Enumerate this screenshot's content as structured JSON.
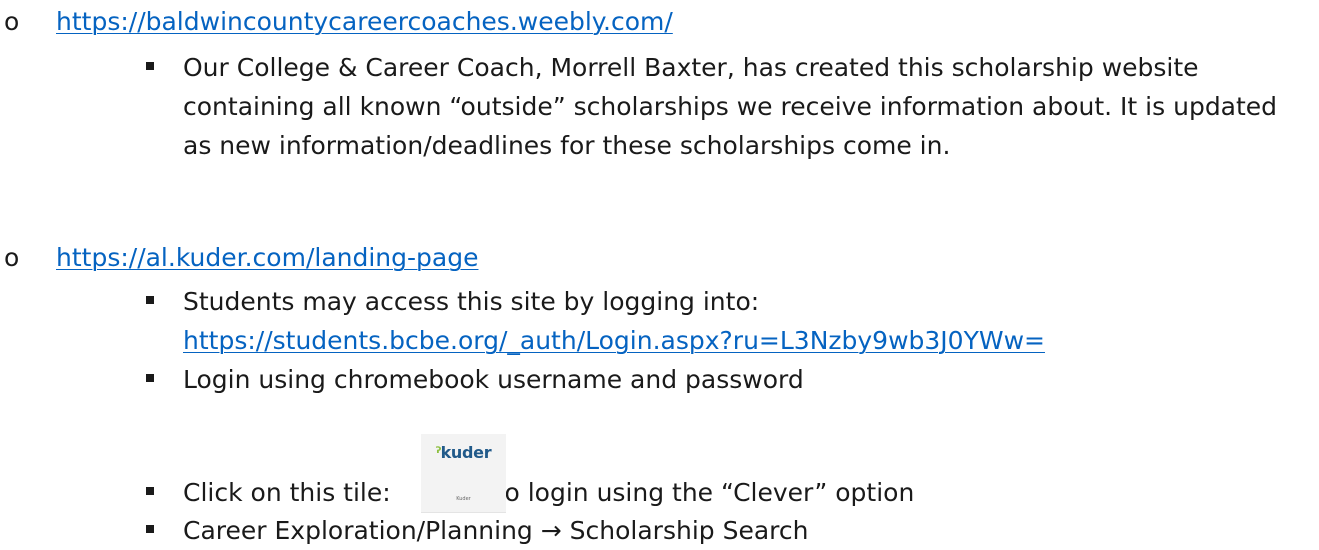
{
  "items": [
    {
      "marker": "o",
      "link": "https://baldwincountycareercoaches.weebly.com/",
      "subitems": [
        {
          "text": "Our College & Career Coach, Morrell Baxter, has created this scholarship website containing all known “outside” scholarships we receive information about. It is updated as new information/deadlines for these scholarships come in."
        }
      ]
    },
    {
      "marker": "o",
      "link": "https://al.kuder.com/landing-page",
      "subitems": [
        {
          "text": "Students may access this site by logging into:",
          "link": "https://students.bcbe.org/_auth/Login.aspx?ru=L3Nzby9wb3J0YWw="
        },
        {
          "text": "Login using chromebook username and password"
        },
        {
          "text_before": "Click on this tile:",
          "tile": {
            "logo_hook": "ˀ",
            "logo": "kuder",
            "caption": "Kuder"
          },
          "text_after": "to login using the “Clever” option"
        },
        {
          "text_before": "Career Exploration/Planning",
          "arrow": "→",
          "text_after": "Scholarship Search"
        }
      ]
    }
  ]
}
